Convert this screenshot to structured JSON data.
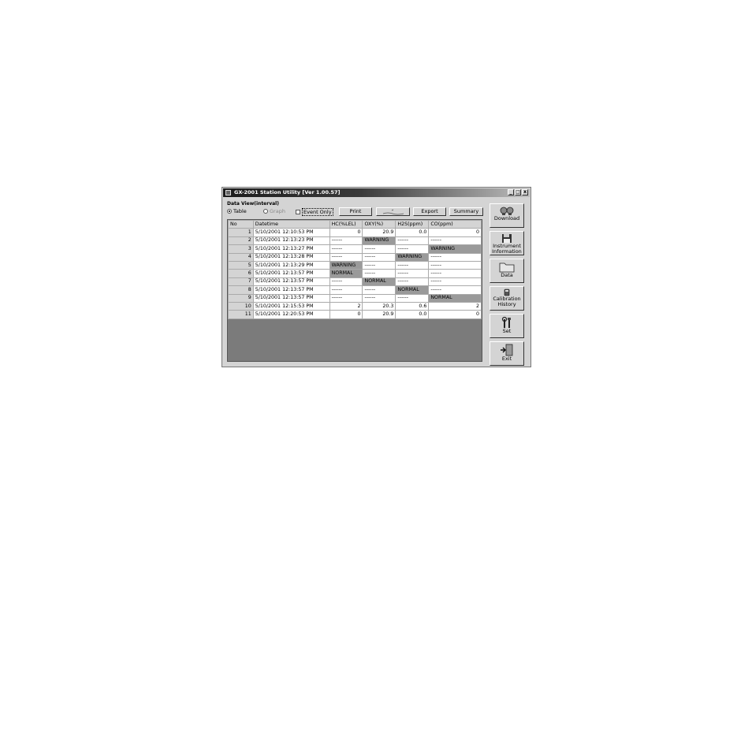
{
  "window": {
    "title": "GX-2001 Station Utility [Ver 1.00.57]",
    "controls": [
      "_",
      "□",
      "x"
    ]
  },
  "data_view": {
    "group_label": "Data View(interval)",
    "options": {
      "table": "Table",
      "graph": "Graph",
      "event_only": "Event Only"
    },
    "buttons": {
      "print": "Print",
      "export": "Export",
      "summary": "Summary"
    }
  },
  "table": {
    "headers": [
      "No",
      "Datetime",
      "HC(%LEL)",
      "OXY(%)",
      "H2S(ppm)",
      "CO(ppm)"
    ],
    "rows": [
      [
        "1",
        "5/10/2001 12:10:53 PM",
        "0",
        "20.9",
        "0.0",
        "0"
      ],
      [
        "2",
        "5/10/2001 12:13:23 PM",
        "------",
        "WARNING",
        "------",
        "------"
      ],
      [
        "3",
        "5/10/2001 12:13:27 PM",
        "------",
        "------",
        "------",
        "WARNING"
      ],
      [
        "4",
        "5/10/2001 12:13:28 PM",
        "------",
        "------",
        "WARNING",
        "------"
      ],
      [
        "5",
        "5/10/2001 12:13:29 PM",
        "WARNING",
        "------",
        "------",
        "------"
      ],
      [
        "6",
        "5/10/2001 12:13:57 PM",
        "NORMAL",
        "------",
        "------",
        "------"
      ],
      [
        "7",
        "5/10/2001 12:13:57 PM",
        "------",
        "NORMAL",
        "------",
        "------"
      ],
      [
        "8",
        "5/10/2001 12:13:57 PM",
        "------",
        "------",
        "NORMAL",
        "------"
      ],
      [
        "9",
        "5/10/2001 12:13:57 PM",
        "------",
        "------",
        "------",
        "NORMAL"
      ],
      [
        "10",
        "5/10/2001 12:15:53 PM",
        "2",
        "20.3",
        "0.6",
        "2"
      ],
      [
        "11",
        "5/10/2001 12:20:53 PM",
        "0",
        "20.9",
        "0.0",
        "0"
      ]
    ]
  },
  "sidebar": {
    "download": "Download",
    "instrument_line1": "Instrument",
    "instrument_line2": "Information",
    "data": "Data",
    "calibration_line1": "Calibration",
    "calibration_line2": "History",
    "set": "Set",
    "exit": "Exit"
  },
  "colors": {
    "titlebar": "#1c1c1c",
    "highlight_cell": "#9a9a9a",
    "grid_background": "#7b7b7b"
  },
  "icons": [
    "download-icon",
    "floppy-disk-icon",
    "folder-icon",
    "calibration-icon",
    "tools-icon",
    "exit-door-icon"
  ]
}
